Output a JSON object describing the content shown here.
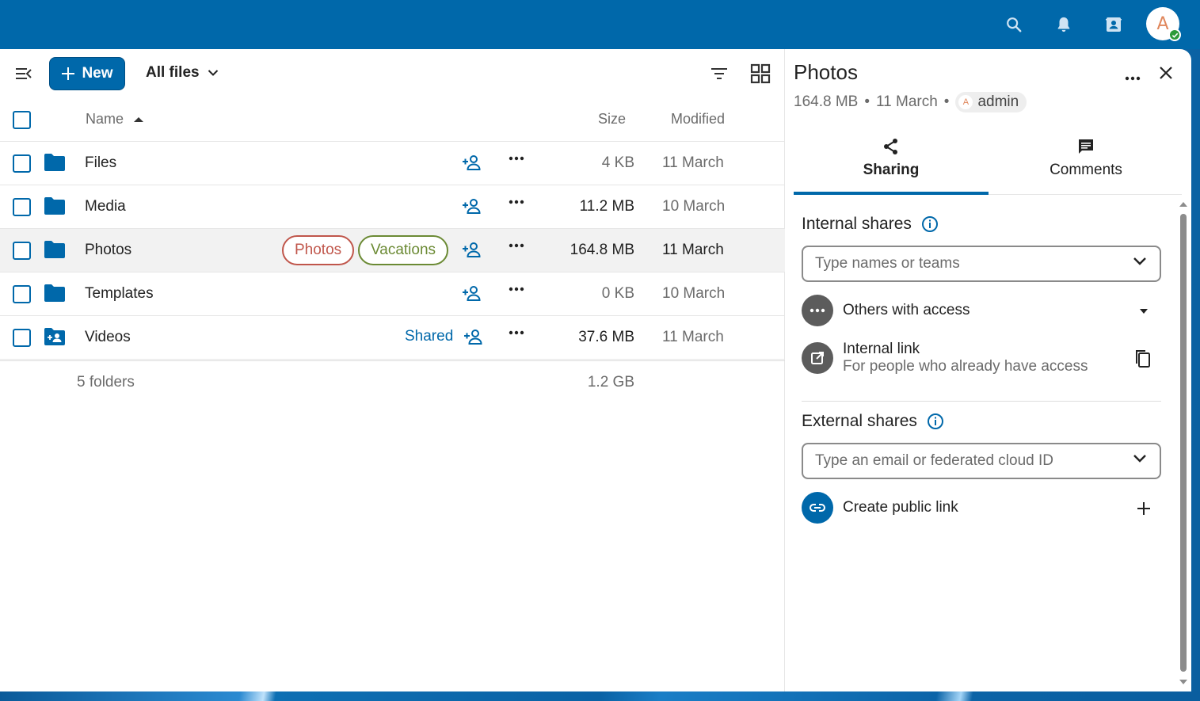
{
  "topbar": {
    "icons": [
      "search-icon",
      "bell-icon",
      "contacts-icon"
    ],
    "user_initial": "A"
  },
  "toolbar": {
    "new_label": "New",
    "breadcrumb": "All files",
    "icons": [
      "menu-collapse-icon",
      "plus-icon",
      "chevron-down-icon",
      "filter-icon",
      "grid-view-icon"
    ]
  },
  "table": {
    "columns": {
      "name": "Name",
      "size": "Size",
      "modified": "Modified"
    },
    "sort_column": "Name",
    "sort_direction": "ascending",
    "rows": [
      {
        "name": "Files",
        "size": "4 KB",
        "modified": "11 March",
        "icon": "folder-icon"
      },
      {
        "name": "Media",
        "size": "11.2 MB",
        "modified": "10 March",
        "icon": "folder-icon"
      },
      {
        "name": "Photos",
        "size": "164.8 MB",
        "modified": "11 March",
        "icon": "folder-icon",
        "tags": [
          "Photos",
          "Vacations"
        ],
        "selected": true
      },
      {
        "name": "Templates",
        "size": "0 KB",
        "modified": "10 March",
        "icon": "folder-icon"
      },
      {
        "name": "Videos",
        "size": "37.6 MB",
        "modified": "11 March",
        "icon": "shared-folder-icon",
        "shared_label": "Shared"
      }
    ],
    "summary": {
      "count": "5 folders",
      "total": "1.2 GB"
    }
  },
  "sidebar": {
    "title": "Photos",
    "size": "164.8 MB",
    "date": "11 March",
    "bullet": "•",
    "owner": "admin",
    "owner_initial": "A",
    "tabs": [
      {
        "label": "Sharing",
        "icon": "share-icon",
        "active": true
      },
      {
        "label": "Comments",
        "icon": "comment-icon",
        "active": false
      }
    ],
    "internal": {
      "title": "Internal shares",
      "placeholder": "Type names or teams",
      "others_label": "Others with access",
      "link_title": "Internal link",
      "link_desc": "For people who already have access"
    },
    "external": {
      "title": "External shares",
      "placeholder": "Type an email or federated cloud ID",
      "public_link": "Create public link"
    }
  },
  "colors": {
    "primary": "#0068aa",
    "tag_photos": "#c0564b",
    "tag_vacations": "#6b8a34",
    "status_online": "#2d9a3a"
  }
}
